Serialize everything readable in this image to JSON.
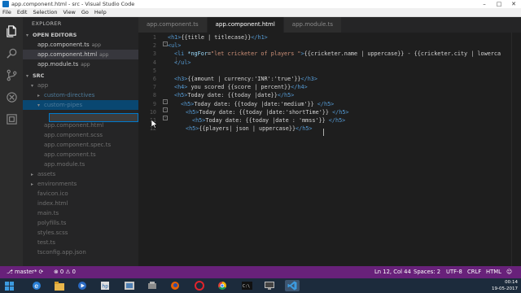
{
  "window": {
    "title": "app.component.html - src - Visual Studio Code"
  },
  "menu": [
    "File",
    "Edit",
    "Selection",
    "View",
    "Go",
    "Help"
  ],
  "sidebar": {
    "title": "EXPLORER",
    "open_editors": {
      "header": "OPEN EDITORS",
      "items": [
        {
          "name": "app.component.ts",
          "suffix": "app"
        },
        {
          "name": "app.component.html",
          "suffix": "app"
        },
        {
          "name": "app.module.ts",
          "suffix": "app"
        }
      ]
    },
    "src_header": "SRC",
    "tree": [
      {
        "name": "app"
      },
      {
        "name": "custom-directives"
      },
      {
        "name": "custom-pipes"
      },
      {
        "name": "app.component.html"
      },
      {
        "name": "app.component.scss"
      },
      {
        "name": "app.component.spec.ts"
      },
      {
        "name": "app.component.ts"
      },
      {
        "name": "app.module.ts"
      },
      {
        "name": "assets"
      },
      {
        "name": "environments"
      },
      {
        "name": "favicon.ico"
      },
      {
        "name": "index.html"
      },
      {
        "name": "main.ts"
      },
      {
        "name": "polyfills.ts"
      },
      {
        "name": "styles.scss"
      },
      {
        "name": "test.ts"
      },
      {
        "name": "tsconfig.app.json"
      }
    ]
  },
  "tabs": [
    {
      "label": "app.component.ts"
    },
    {
      "label": "app.component.html"
    },
    {
      "label": "app.module.ts"
    }
  ],
  "editor": {
    "line_numbers": [
      "1",
      "2",
      "3",
      "4",
      "5",
      "6",
      "7",
      "8",
      "9",
      "10",
      "11",
      "12"
    ],
    "lines": [
      [
        [
          "tag",
          "<h1>"
        ],
        [
          "txt",
          "{{title | titlecase}}"
        ],
        [
          "tag",
          "</h1>"
        ]
      ],
      [
        [
          "tag",
          "<ul>"
        ]
      ],
      [
        [
          "tag",
          "<li "
        ],
        [
          "attr",
          "*ngFor"
        ],
        [
          "txt",
          "="
        ],
        [
          "str",
          "\"let cricketer of players \""
        ],
        [
          "tag",
          ">"
        ],
        [
          "txt",
          "{{cricketer.name | uppercase}} - {{cricketer.city | lowerca"
        ]
      ],
      [
        [
          "tag",
          "</ul>"
        ]
      ],
      [],
      [
        [
          "tag",
          "<h3>"
        ],
        [
          "txt",
          "{{amount | currency:'INR':'true'}}"
        ],
        [
          "tag",
          "</h3>"
        ]
      ],
      [
        [
          "tag",
          "<h4>"
        ],
        [
          "txt",
          " you scored {{score | percent}}"
        ],
        [
          "tag",
          "</h4>"
        ]
      ],
      [
        [
          "tag",
          "<h5>"
        ],
        [
          "txt",
          "Today date: {{today |date}}"
        ],
        [
          "tag",
          "</h5>"
        ]
      ],
      [
        [
          "tag",
          "<h5>"
        ],
        [
          "txt",
          "Today date: {{today |date:'medium'}} "
        ],
        [
          "tag",
          "</h5>"
        ]
      ],
      [
        [
          "tag",
          "<h5>"
        ],
        [
          "txt",
          "Today date: {{today |date:'shortTime'}} "
        ],
        [
          "tag",
          "</h5>"
        ]
      ],
      [
        [
          "tag",
          "<h5>"
        ],
        [
          "txt",
          "Today date: {{today |date : 'mmss'}} "
        ],
        [
          "tag",
          "</h5>"
        ]
      ],
      [
        [
          "tag",
          "<h5>"
        ],
        [
          "txt",
          "{{players| json | uppercase}}"
        ],
        [
          "tag",
          "</h5>"
        ]
      ]
    ]
  },
  "status": {
    "branch": "master*",
    "errors": "0",
    "warnings": "0",
    "position": "Ln 12, Col 44",
    "spaces": "Spaces: 2",
    "encoding": "UTF-8",
    "eol": "CRLF",
    "language": "HTML"
  },
  "tray": {
    "time": "00:14",
    "date": "19-05-2017"
  },
  "colors": {
    "statusbar": "#68217a",
    "accent": "#007acc"
  }
}
